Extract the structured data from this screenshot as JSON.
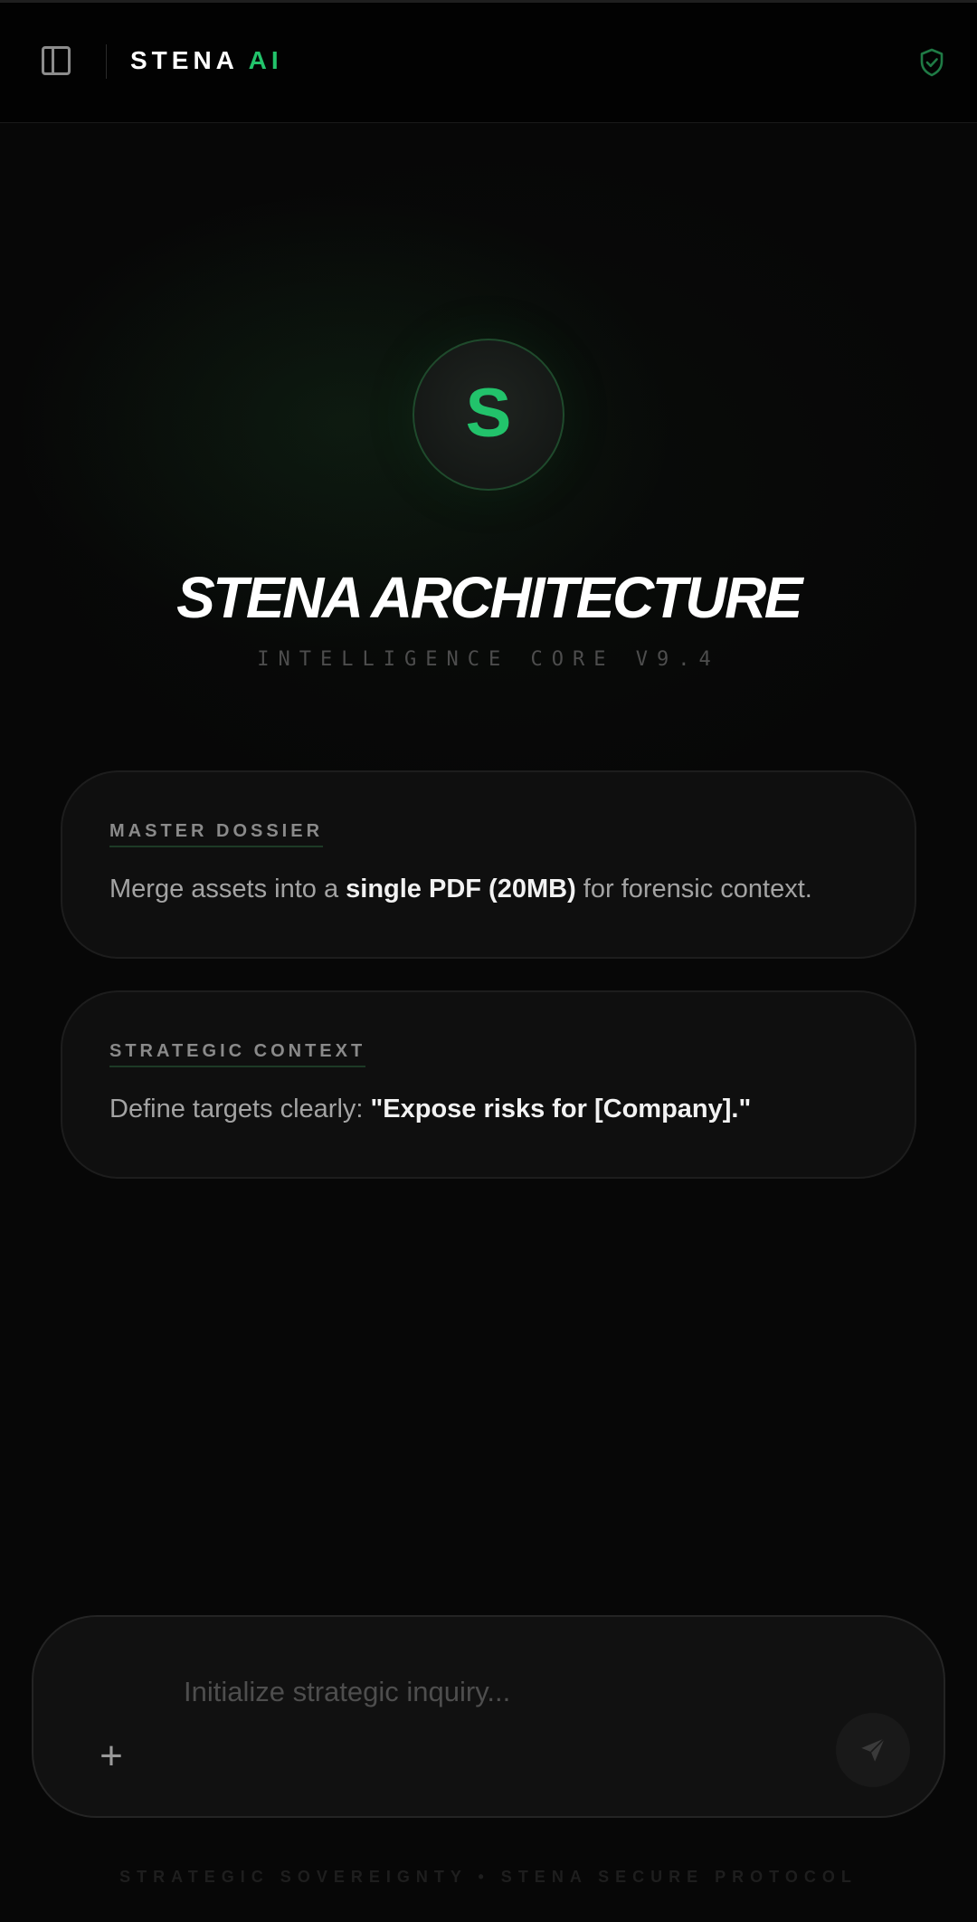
{
  "header": {
    "brand_main": "STENA",
    "brand_accent": "AI",
    "sidebar_icon": "sidebar-toggle-icon",
    "status_icon": "shield-check-icon"
  },
  "hero": {
    "logo_letter": "S",
    "title": "STENA ARCHITECTURE",
    "subtitle": "INTELLIGENCE CORE V9.4"
  },
  "cards": [
    {
      "label": "MASTER DOSSIER",
      "text_before": "Merge assets into a ",
      "text_bold": "single PDF (20MB)",
      "text_after": " for forensic context."
    },
    {
      "label": "STRATEGIC CONTEXT",
      "text_before": "Define targets clearly: ",
      "text_bold": "\"Expose risks for [Company].\"",
      "text_after": ""
    }
  ],
  "composer": {
    "placeholder": "Initialize strategic inquiry...",
    "value": "",
    "attach_icon": "plus-icon",
    "send_icon": "send-icon"
  },
  "footer": {
    "text": "STRATEGIC SOVEREIGNTY • STENA SECURE PROTOCOL"
  },
  "colors": {
    "accent": "#22c36b",
    "background": "#070707",
    "card": "#0f0f0f"
  }
}
